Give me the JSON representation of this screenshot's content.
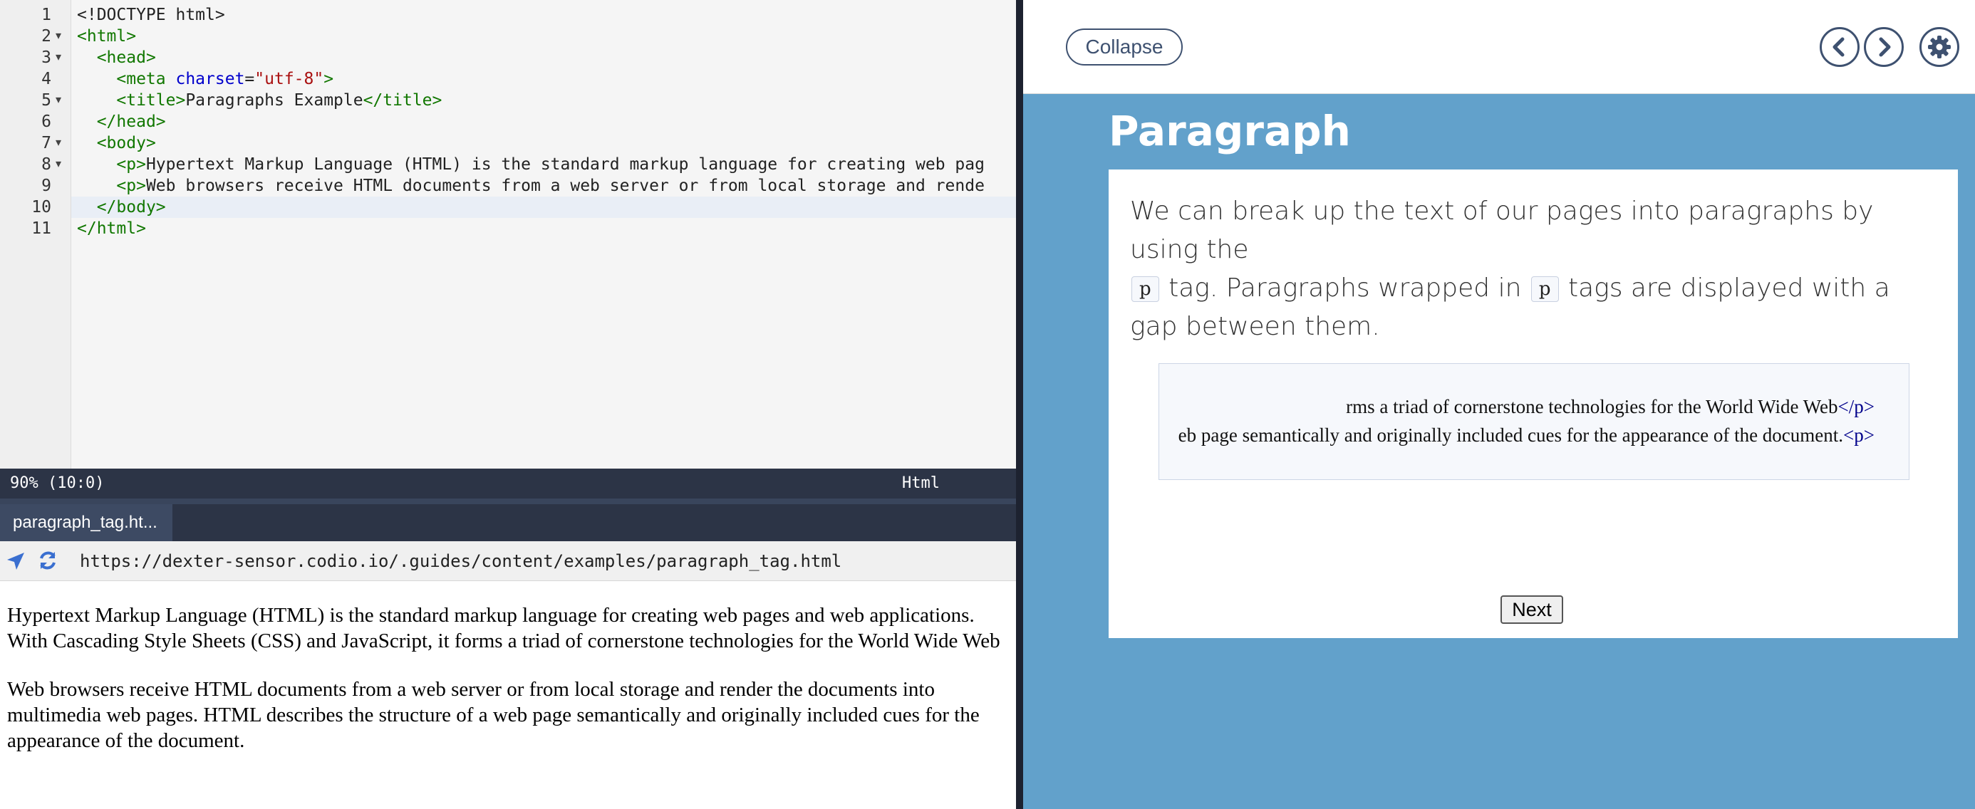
{
  "editor": {
    "line_numbers": [
      "1",
      "2",
      "3",
      "4",
      "5",
      "6",
      "7",
      "8",
      "9",
      "10",
      "11"
    ],
    "folded_lines": [
      2,
      3,
      5,
      7,
      8
    ],
    "lines": [
      {
        "indent": "",
        "parts": [
          {
            "t": "plain",
            "v": "<!DOCTYPE html>"
          }
        ]
      },
      {
        "indent": "",
        "parts": [
          {
            "t": "tag",
            "v": "<html>"
          }
        ]
      },
      {
        "indent": "  ",
        "parts": [
          {
            "t": "tag",
            "v": "<head>"
          }
        ]
      },
      {
        "indent": "    ",
        "parts": [
          {
            "t": "tag",
            "v": "<meta "
          },
          {
            "t": "attr",
            "v": "charset"
          },
          {
            "t": "plain",
            "v": "="
          },
          {
            "t": "str",
            "v": "\"utf-8\""
          },
          {
            "t": "tag",
            "v": ">"
          }
        ]
      },
      {
        "indent": "    ",
        "parts": [
          {
            "t": "tag",
            "v": "<title>"
          },
          {
            "t": "plain",
            "v": "Paragraphs Example"
          },
          {
            "t": "tag",
            "v": "</title>"
          }
        ]
      },
      {
        "indent": "  ",
        "parts": [
          {
            "t": "tag",
            "v": "</head>"
          }
        ]
      },
      {
        "indent": "  ",
        "parts": [
          {
            "t": "tag",
            "v": "<body>"
          }
        ]
      },
      {
        "indent": "    ",
        "parts": [
          {
            "t": "tag",
            "v": "<p>"
          },
          {
            "t": "plain",
            "v": "Hypertext Markup Language (HTML) is the standard markup language for creating web pag"
          }
        ]
      },
      {
        "indent": "    ",
        "parts": [
          {
            "t": "tag",
            "v": "<p>"
          },
          {
            "t": "plain",
            "v": "Web browsers receive HTML documents from a web server or from local storage and rende"
          }
        ]
      },
      {
        "indent": "  ",
        "parts": [
          {
            "t": "tag",
            "v": "</body>"
          }
        ]
      },
      {
        "indent": "",
        "parts": [
          {
            "t": "tag",
            "v": "</html>"
          }
        ]
      }
    ],
    "status_position": "90% (10:0)",
    "status_mode": "Html"
  },
  "preview_tab": {
    "label": "paragraph_tag.ht..."
  },
  "urlbar": {
    "url": "https://dexter-sensor.codio.io/.guides/content/examples/paragraph_tag.html"
  },
  "preview": {
    "paragraphs": [
      "Hypertext Markup Language (HTML) is the standard markup language for creating web pages and web applications. With Cascading Style Sheets (CSS) and JavaScript, it forms a triad of cornerstone technologies for the World Wide Web",
      "Web browsers receive HTML documents from a web server or from local storage and render the documents into multimedia web pages. HTML describes the structure of a web page semantically and originally included cues for the appearance of the document."
    ]
  },
  "guide": {
    "collapse_label": "Collapse",
    "title": "Paragraph",
    "text_part1": "We can break up the text of our pages into paragraphs by using the",
    "chip": "p",
    "text_part2": "tag. Paragraphs wrapped in",
    "text_part3": "tags are displayed with a gap between them.",
    "example_line1_text": "rms a triad of cornerstone technologies for the World Wide Web",
    "example_line1_tag": "</p>",
    "example_line2_text": "eb page semantically and originally included cues for the appearance of the document.",
    "example_line2_tag": "<p>",
    "next_label": "Next"
  },
  "colors": {
    "guide_background": "#62a1cb",
    "statusbar": "#2c3446",
    "tag_green": "#117700",
    "attr_blue": "#0000cc",
    "string_red": "#aa1111"
  },
  "icons": [
    "location-arrow-icon",
    "refresh-icon",
    "chevron-left-icon",
    "chevron-right-icon",
    "gear-icon"
  ]
}
